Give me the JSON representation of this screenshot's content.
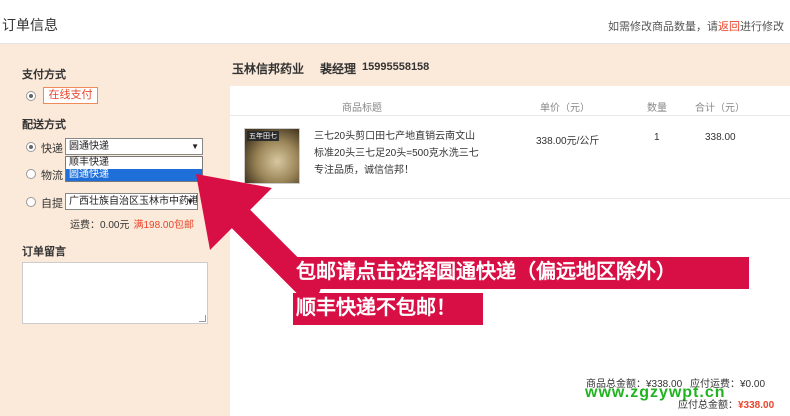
{
  "header": {
    "title": "订单信息",
    "hint_before": "如需修改商品数量，请",
    "hint_link": "返回",
    "hint_after": "进行修改"
  },
  "payment": {
    "title": "支付方式",
    "button": "在线支付"
  },
  "shipping": {
    "title": "配送方式",
    "express_label": "快递",
    "express_selected": "圆通快递",
    "dropdown_options": [
      "顺丰快递",
      "圆通快递"
    ],
    "logistics_label": "物流",
    "pickup_label": "自提",
    "pickup_selected": "广西壮族自治区玉林市中药港",
    "fee_text": "运费：0.00元",
    "free_text": "满198.00包邮"
  },
  "remark": {
    "title": "订单留言"
  },
  "store": {
    "name": "玉林信邦药业",
    "manager": "裴经理",
    "phone": "15995558158"
  },
  "table": {
    "headers": [
      "商品标题",
      "单价（元）",
      "数量",
      "合计（元）"
    ],
    "product": {
      "title": "三七20头剪口田七产地直销云南文山标准20头三七足20头=500克水洗三七专注品质，诚信信邦！",
      "image_tag": "五年田七",
      "price": "338.00元/公斤",
      "qty": "1",
      "subtotal": "338.00"
    }
  },
  "totals": {
    "goods_label": "商品总金额：",
    "goods_value": "¥338.00",
    "freight_label": "应付运费：",
    "freight_value": "¥0.00",
    "payable_label": "应付总金额：",
    "payable_value": "¥338.00"
  },
  "banner": {
    "line1": "包邮请点击选择圆通快递（偏远地区除外）",
    "line2": "顺丰快递不包邮！"
  },
  "watermark": "www.zgzywpt.cn",
  "colors": {
    "accent": "#e8452c",
    "banner": "#d80f45",
    "panel": "#fbe9d9",
    "select_highlight": "#1e6fd9"
  }
}
